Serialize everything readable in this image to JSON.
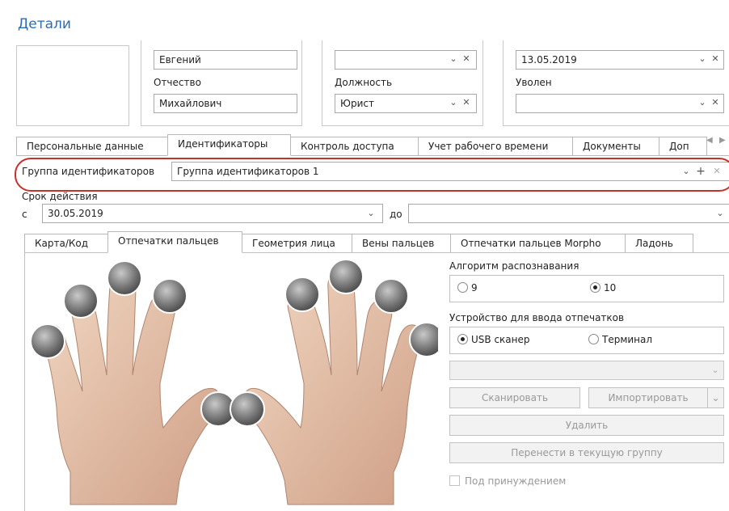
{
  "title": "Детали",
  "top_form": {
    "first_name_value": "Евгений",
    "middle_name_label": "Отчество",
    "middle_name_value": "Михайлович",
    "position_label": "Должность",
    "position_value": "Юрист",
    "date_value": "13.05.2019",
    "fired_label": "Уволен"
  },
  "main_tabs": [
    "Персональные данные",
    "Идентификаторы",
    "Контроль доступа",
    "Учет рабочего времени",
    "Документы",
    "Доп"
  ],
  "id_group": {
    "label": "Группа идентификаторов",
    "value": "Группа идентификаторов 1"
  },
  "validity": {
    "label": "Срок действия",
    "from_label": "с",
    "from_value": "30.05.2019",
    "to_label": "до",
    "to_value": ""
  },
  "sub_tabs": [
    "Карта/Код",
    "Отпечатки пальцев",
    "Геометрия лица",
    "Вены пальцев",
    "Отпечатки пальцев Morpho",
    "Ладонь"
  ],
  "algorithm": {
    "label": "Алгоритм распознавания",
    "options": [
      "9",
      "10"
    ],
    "selected": "10"
  },
  "device": {
    "label": "Устройство для ввода отпечатков",
    "options": [
      "USB сканер",
      "Терминал"
    ],
    "selected": "USB сканер"
  },
  "buttons": {
    "scan": "Сканировать",
    "import": "Импортировать",
    "delete": "Удалить",
    "move": "Перенести в текущую группу"
  },
  "duress_label": "Под принуждением",
  "icons": {
    "dropdown": "chevron-down-icon",
    "clear": "close-icon",
    "add": "plus-icon"
  }
}
